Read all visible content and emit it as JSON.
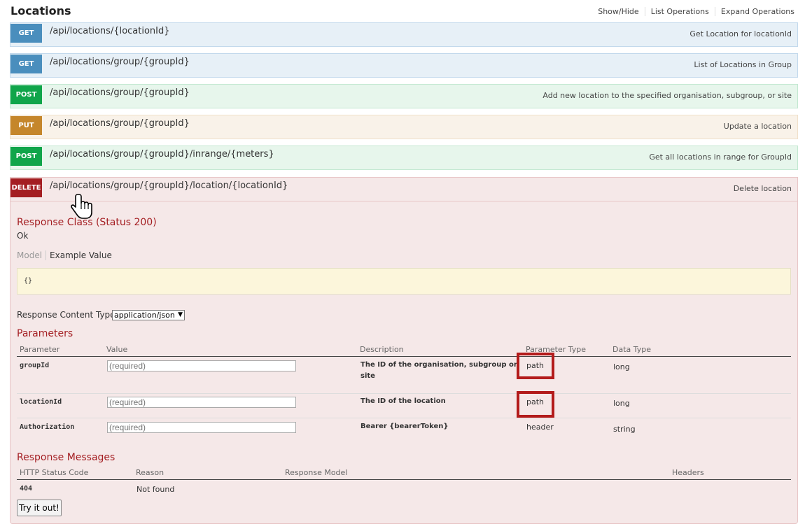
{
  "header": {
    "title": "Locations",
    "links": [
      "Show/Hide",
      "List Operations",
      "Expand Operations"
    ]
  },
  "operations": [
    {
      "method": "GET",
      "path": "/api/locations/{locationId}",
      "summary": "Get Location for locationId"
    },
    {
      "method": "GET",
      "path": "/api/locations/group/{groupId}",
      "summary": "List of Locations in Group"
    },
    {
      "method": "POST",
      "path": "/api/locations/group/{groupId}",
      "summary": "Add new location to the specified organisation, subgroup, or site"
    },
    {
      "method": "PUT",
      "path": "/api/locations/group/{groupId}",
      "summary": "Update a location"
    },
    {
      "method": "POST",
      "path": "/api/locations/group/{groupId}/inrange/{meters}",
      "summary": "Get all locations in range for GroupId"
    },
    {
      "method": "DELETE",
      "path": "/api/locations/group/{groupId}/location/{locationId}",
      "summary": "Delete location"
    }
  ],
  "detail": {
    "response_class_title": "Response Class (Status 200)",
    "response_class_value": "Ok",
    "tab_model": "Model",
    "tab_example": "Example Value",
    "example_value": "{}",
    "content_type_label": "Response Content Type",
    "content_type_selected": "application/json",
    "parameters_title": "Parameters",
    "param_headers": [
      "Parameter",
      "Value",
      "Description",
      "Parameter Type",
      "Data Type"
    ],
    "params": [
      {
        "name": "groupId",
        "placeholder": "(required)",
        "description": "The ID of the organisation, subgroup or site",
        "param_type": "path",
        "data_type": "long"
      },
      {
        "name": "locationId",
        "placeholder": "(required)",
        "description": "The ID of the location",
        "param_type": "path",
        "data_type": "long"
      },
      {
        "name": "Authorization",
        "placeholder": "(required)",
        "description": "Bearer {bearerToken}",
        "param_type": "header",
        "data_type": "string"
      }
    ],
    "messages_title": "Response Messages",
    "message_headers": [
      "HTTP Status Code",
      "Reason",
      "Response Model",
      "Headers"
    ],
    "messages": [
      {
        "code": "404",
        "reason": "Not found"
      }
    ],
    "try_button": "Try it out!"
  },
  "colors": {
    "get": "#4a8ebd",
    "post": "#10a54a",
    "put": "#c5862b",
    "delete": "#a41e22",
    "highlight_box": "#b31b1b"
  },
  "icons": [
    "hand-pointer-cursor"
  ]
}
